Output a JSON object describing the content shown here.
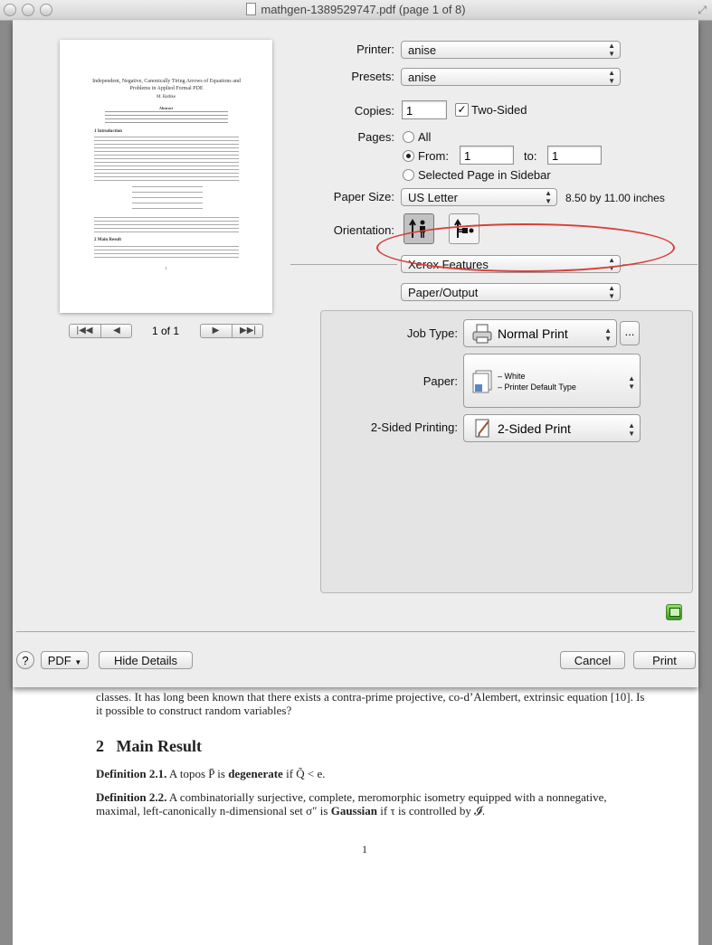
{
  "window": {
    "title": "mathgen-1389529747.pdf (page 1 of 8)"
  },
  "preview": {
    "page_indicator": "1 of 1",
    "thumb": {
      "title": "Independent, Negative, Canonically Tiring Arrows of Equations and Problems in Applied Formal PDE",
      "author": "M. Rathke",
      "abstract_heading": "Abstract",
      "section1": "1   Introduction",
      "section2": "2   Main Result",
      "page_number": "1"
    }
  },
  "form": {
    "printer_label": "Printer:",
    "printer_value": "anise",
    "presets_label": "Presets:",
    "presets_value": "anise",
    "copies_label": "Copies:",
    "copies_value": "1",
    "two_sided_label": "Two-Sided",
    "two_sided_checked": true,
    "pages_label": "Pages:",
    "pages_all": "All",
    "pages_from": "From:",
    "from_value": "1",
    "pages_to": "to:",
    "to_value": "1",
    "pages_selected": "Selected Page in Sidebar",
    "paper_size_label": "Paper Size:",
    "paper_size_value": "US Letter",
    "paper_dims": "8.50 by 11.00 inches",
    "orientation_label": "Orientation:",
    "xerox_features": "Xerox Features",
    "paper_output": "Paper/Output"
  },
  "panel": {
    "job_type_label": "Job Type:",
    "job_type_value": "Normal Print",
    "more_button": "...",
    "paper_label": "Paper:",
    "paper_line1": "– White",
    "paper_line2": "– Printer Default Type",
    "two_sided_printing_label": "2-Sided Printing:",
    "two_sided_printing_value": "2-Sided Print"
  },
  "footer": {
    "help": "?",
    "pdf": "PDF",
    "hide_details": "Hide Details",
    "cancel": "Cancel",
    "print": "Print"
  },
  "document": {
    "para_tail": "classes.  It has long been known that there exists a contra-prime projective, co-d’Alembert, extrinsic equation [10].  Is it possible to construct random variables?",
    "section_num": "2",
    "section_title": "Main Result",
    "def21_label": "Definition 2.1.",
    "def21_text_a": "A topos P̄ is",
    "def21_bold": "degenerate",
    "def21_text_b": "if Q̃ < e.",
    "def22_label": "Definition 2.2.",
    "def22_text_a": "A combinatorially surjective, complete, meromorphic isometry equipped with a nonnegative, maximal, left-canonically n-dimensional set σ″ is",
    "def22_bold": "Gaussian",
    "def22_text_b": "if τ is controlled by 𝓘.",
    "page_number": "1"
  },
  "colors": {
    "annotation_oval": "#d8403a"
  }
}
